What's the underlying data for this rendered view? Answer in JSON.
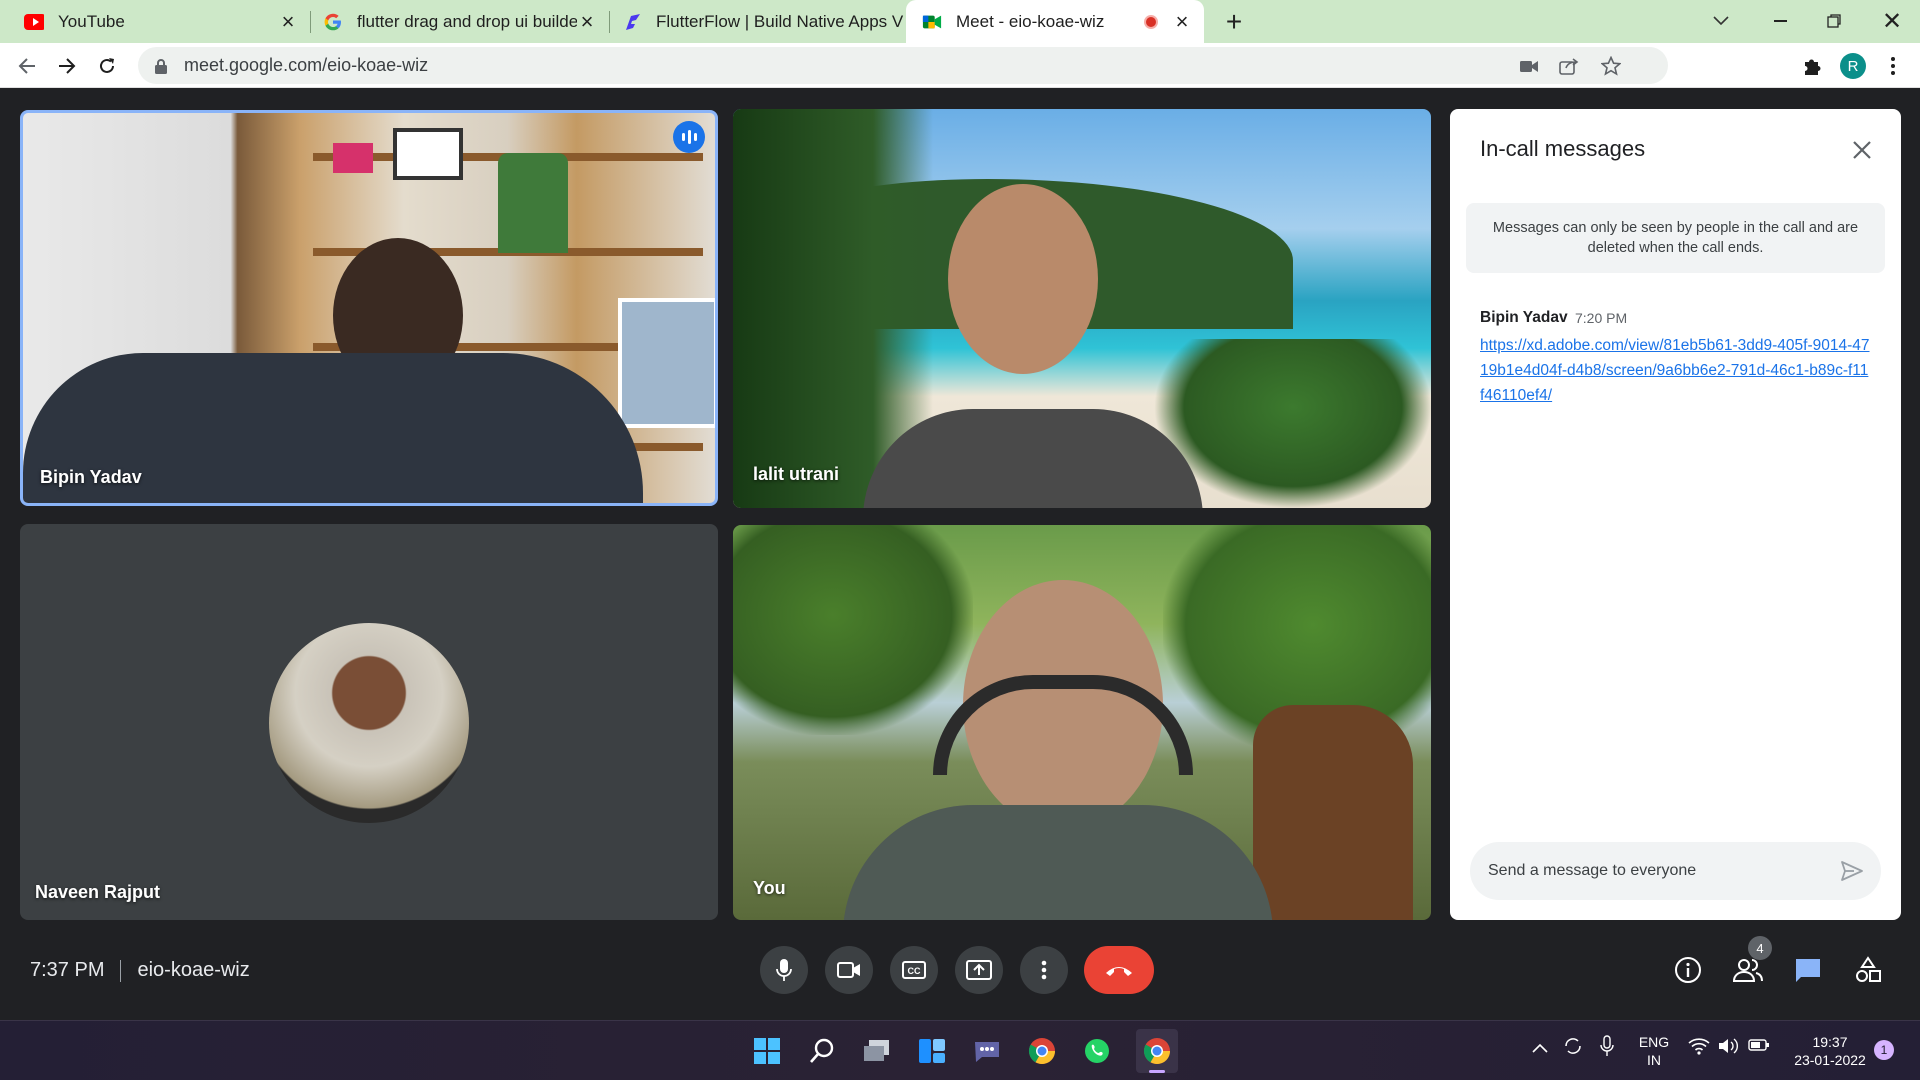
{
  "browser": {
    "tabs": [
      {
        "title": "YouTube",
        "icon": "youtube-icon"
      },
      {
        "title": "flutter drag and drop ui builder -",
        "icon": "google-icon"
      },
      {
        "title": "FlutterFlow | Build Native Apps V",
        "icon": "flutterflow-icon"
      },
      {
        "title": "Meet - eio-koae-wiz",
        "icon": "meet-icon",
        "active": true
      }
    ],
    "url": "meet.google.com/eio-koae-wiz",
    "profile_initial": "R"
  },
  "meeting": {
    "participants": [
      {
        "name": "Bipin Yadav"
      },
      {
        "name": "lalit utrani"
      },
      {
        "name": "Naveen Rajput"
      },
      {
        "name": "You"
      }
    ],
    "time": "7:37 PM",
    "code": "eio-koae-wiz",
    "people_count": "4"
  },
  "chat": {
    "title": "In-call messages",
    "notice": "Messages can only be seen by people in the call and are deleted when the call ends.",
    "message": {
      "sender": "Bipin Yadav",
      "time": "7:20 PM",
      "link": "https://xd.adobe.com/view/81eb5b61-3dd9-405f-9014-4719b1e4d04f-d4b8/screen/9a6bb6e2-791d-46c1-b89c-f11f46110ef4/"
    },
    "input_placeholder": "Send a message to everyone"
  },
  "taskbar": {
    "lang_top": "ENG",
    "lang_bottom": "IN",
    "clock_time": "19:37",
    "clock_date": "23-01-2022",
    "notification_count": "1"
  },
  "colors": {
    "meet_bg": "#202124",
    "accent": "#1a73e8",
    "end_call": "#ea4335",
    "tab_strip": "#cde8c8"
  }
}
